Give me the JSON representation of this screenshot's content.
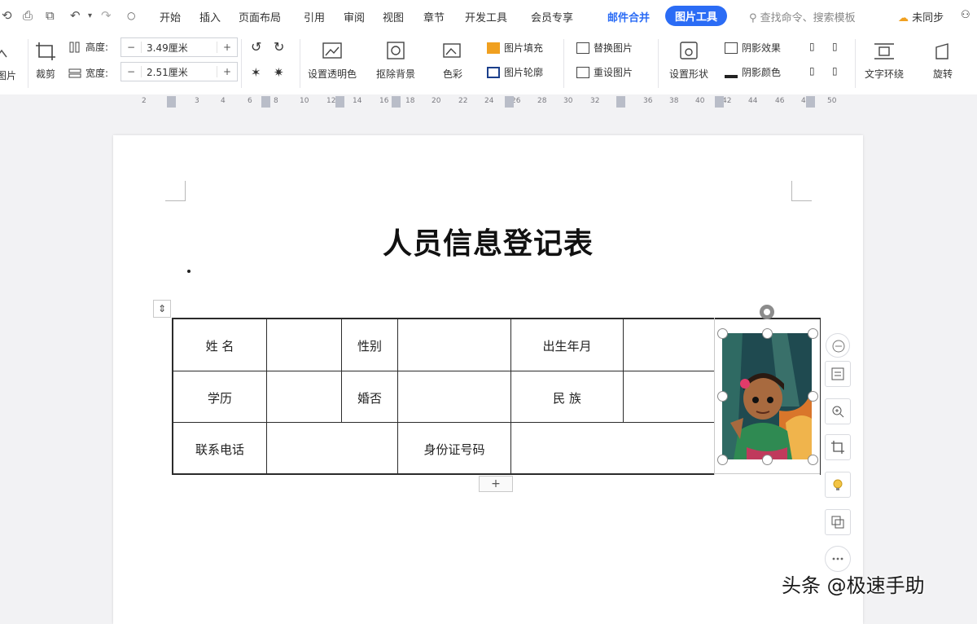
{
  "menu": {
    "tabs": [
      {
        "label": "开始"
      },
      {
        "label": "插入"
      },
      {
        "label": "页面布局"
      },
      {
        "label": "引用"
      },
      {
        "label": "审阅"
      },
      {
        "label": "视图"
      },
      {
        "label": "章节"
      },
      {
        "label": "开发工具"
      },
      {
        "label": "会员专享"
      },
      {
        "label": "邮件合并"
      },
      {
        "label": "图片工具"
      }
    ],
    "search_placeholder": "查找命令、搜索模板",
    "cloud_status": "未同步",
    "active_tab_color": "#2b6cf5"
  },
  "ribbon": {
    "left_cut_label": "图片",
    "crop_label": "裁剪",
    "height_label": "高度:",
    "width_label": "宽度:",
    "height_value": "3.49厘米",
    "width_value": "2.51厘米",
    "set_transparent_label": "设置透明色",
    "remove_bg_label": "抠除背景",
    "color_label": "色彩",
    "pic_fill_label": "图片填充",
    "pic_outline_label": "图片轮廓",
    "change_pic_label": "替换图片",
    "reset_pic_label": "重设图片",
    "set_shape_label": "设置形状",
    "shadow_effect_label": "阴影效果",
    "shadow_color_label": "阴影颜色",
    "text_wrap_label": "文字环绕",
    "rotate_label": "旋转"
  },
  "ruler": {
    "ticks": [
      "2",
      "2",
      "3",
      "4",
      "6",
      "8",
      "10",
      "12",
      "14",
      "16",
      "18",
      "20",
      "22",
      "24",
      "26",
      "28",
      "30",
      "32",
      "34",
      "36",
      "38",
      "40",
      "42",
      "44",
      "46",
      "48",
      "50"
    ]
  },
  "document": {
    "title": "人员信息登记表",
    "table": {
      "row1": [
        "姓 名",
        "",
        "性别",
        "",
        "出生年月",
        ""
      ],
      "row2": [
        "学历",
        "",
        "婚否",
        "",
        "民 族",
        ""
      ],
      "row3": [
        "联系电话",
        "",
        "身份证号码",
        ""
      ]
    },
    "add_row_label": "+",
    "move_handle_label": "⇕"
  },
  "watermark": "头条 @极速手助"
}
